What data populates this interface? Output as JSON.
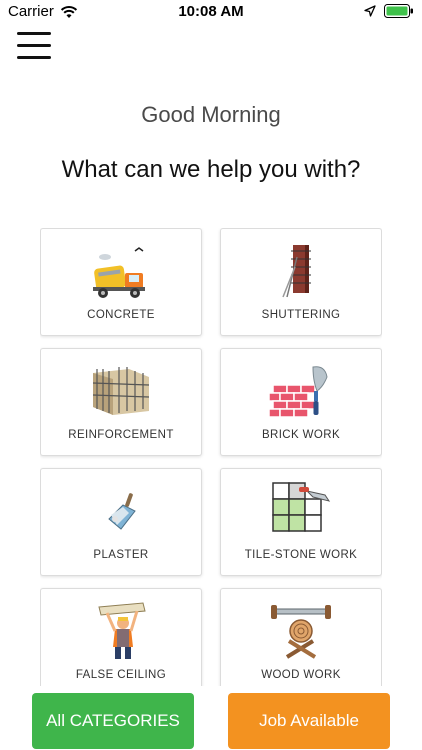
{
  "status_bar": {
    "carrier": "Carrier",
    "time": "10:08 AM"
  },
  "greeting": "Good Morning",
  "headline": "What can we help you with?",
  "categories": [
    {
      "label": "CONCRETE",
      "icon": "concrete-mixer-truck-icon"
    },
    {
      "label": "SHUTTERING",
      "icon": "shuttering-column-icon"
    },
    {
      "label": "REINFORCEMENT",
      "icon": "reinforcement-rebar-icon"
    },
    {
      "label": "BRICK WORK",
      "icon": "brick-trowel-icon"
    },
    {
      "label": "PLASTER",
      "icon": "plaster-trowel-icon"
    },
    {
      "label": "TILE-STONE WORK",
      "icon": "tile-grid-icon"
    },
    {
      "label": "FALSE CEILING",
      "icon": "false-ceiling-worker-icon"
    },
    {
      "label": "WOOD WORK",
      "icon": "wood-saw-icon"
    }
  ],
  "buttons": {
    "all_categories": "All CATEGORIES",
    "job_available": "Job Available"
  },
  "colors": {
    "green": "#3fb54b",
    "orange": "#f39220",
    "battery": "#3fc24b"
  }
}
